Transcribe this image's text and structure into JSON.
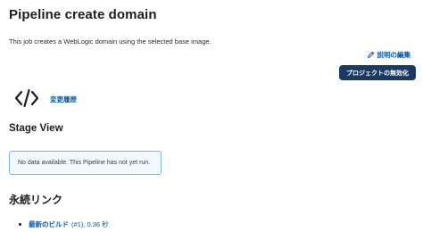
{
  "page": {
    "title": "Pipeline create domain",
    "description": "This job creates a WebLogic domain using the selected base image."
  },
  "actions": {
    "edit_description": "説明の編集",
    "edit_icon": "pencil-icon",
    "disable_project": "プロジェクトの無効化"
  },
  "changes": {
    "icon": "code-brackets-icon",
    "label": "変更履歴"
  },
  "stage_view": {
    "heading": "Stage View",
    "message": "No data available. This Pipeline has not yet run."
  },
  "permalinks": {
    "heading": "永続リンク",
    "items": [
      {
        "label": "最新のビルド",
        "detail": "(#1), 0.36 秒"
      }
    ]
  },
  "colors": {
    "link": "#0b58a6",
    "button_bg": "#1b3a63",
    "notice_border": "#7ab9d9"
  }
}
